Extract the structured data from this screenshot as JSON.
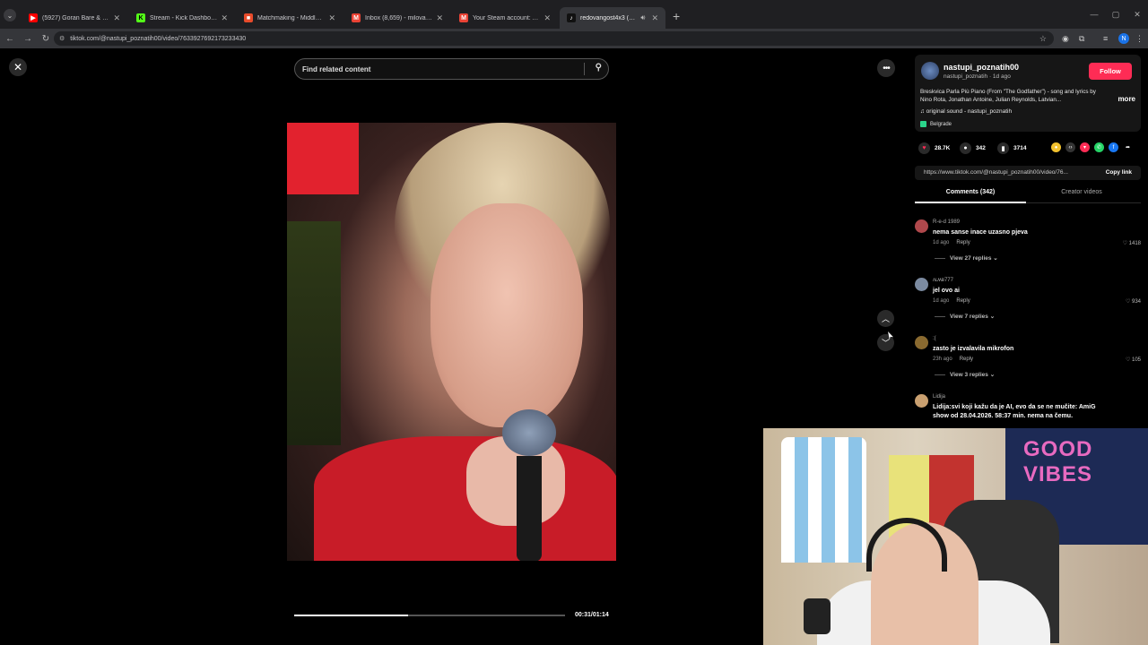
{
  "browser": {
    "tabs": [
      {
        "title": "(5927) Goran Bare & Majke - To...",
        "favicon_color": "#ff0000",
        "favicon": "▶"
      },
      {
        "title": "Stream - Kick Dashboard",
        "favicon_color": "#53fc18",
        "favicon": "K"
      },
      {
        "title": "Matchmaking - Middle East Se...",
        "favicon_color": "#e84b2b",
        "favicon": "■"
      },
      {
        "title": "Inbox (8,659) - milovanovicmen...",
        "favicon_color": "#ea4335",
        "favicon": "M"
      },
      {
        "title": "Your Steam account: Access fro...",
        "favicon_color": "#ea4335",
        "favicon": "M"
      },
      {
        "title": "redovangost4x3 (@redova...",
        "favicon_color": "#111111",
        "favicon": "♪"
      }
    ],
    "url": "tiktok.com/@nastupi_poznatih00/video/7633927692173233430",
    "profile_initial": "N"
  },
  "search": {
    "placeholder": "Find related content"
  },
  "video": {
    "timecode": "00:31/01:14",
    "progress": 0.42
  },
  "post": {
    "author_name": "nastupi_poznatih00",
    "author_sub": "nastupi_poznatih · 1d ago",
    "follow_label": "Follow",
    "description": "Breskvica Parla Più Piano (From \"The Godfather\") - song and lyrics by Nino Rota, Jonathan Antoine, Julian Reynolds, Latvian...",
    "more_label": "more",
    "sound": "♫  original sound - nastupi_poznatih",
    "location": "Belgrade",
    "likes": "28.7K",
    "comments_count": "342",
    "saves": "3714",
    "share_link": "https://www.tiktok.com/@nastupi_poznatih00/video/76...",
    "copy_link_label": "Copy link",
    "tab_comments": "Comments (342)",
    "tab_creator": "Creator videos"
  },
  "comments": [
    {
      "user": "R-e-d 1989",
      "text": "nema sanse inace uzasno pjeva",
      "time": "1d ago",
      "reply": "Reply",
      "likes": "1418",
      "replies": "View 27 replies",
      "avatar_color": "#b0484c"
    },
    {
      "user": "ʌʟʍʙ777",
      "text": "jel ovo ai",
      "time": "1d ago",
      "reply": "Reply",
      "likes": "934",
      "replies": "View 7 replies",
      "avatar_color": "#7b8aa0"
    },
    {
      "user": ":(",
      "text": "zasto je izvalavila mikrofon",
      "time": "23h ago",
      "reply": "Reply",
      "likes": "105",
      "replies": "View 3 replies",
      "avatar_color": "#8a6a30"
    },
    {
      "user": "Lidija",
      "text": "Lidija:svi koji kažu da je AI, evo da se ne mučite: AmiG show od 28.04.2026. 58:37 min. nema na čemu.",
      "time": "",
      "reply": "",
      "likes": "",
      "replies": "",
      "avatar_color": "#c9a070"
    }
  ],
  "webcam": {
    "neon_text": "GOOD VIBES"
  }
}
